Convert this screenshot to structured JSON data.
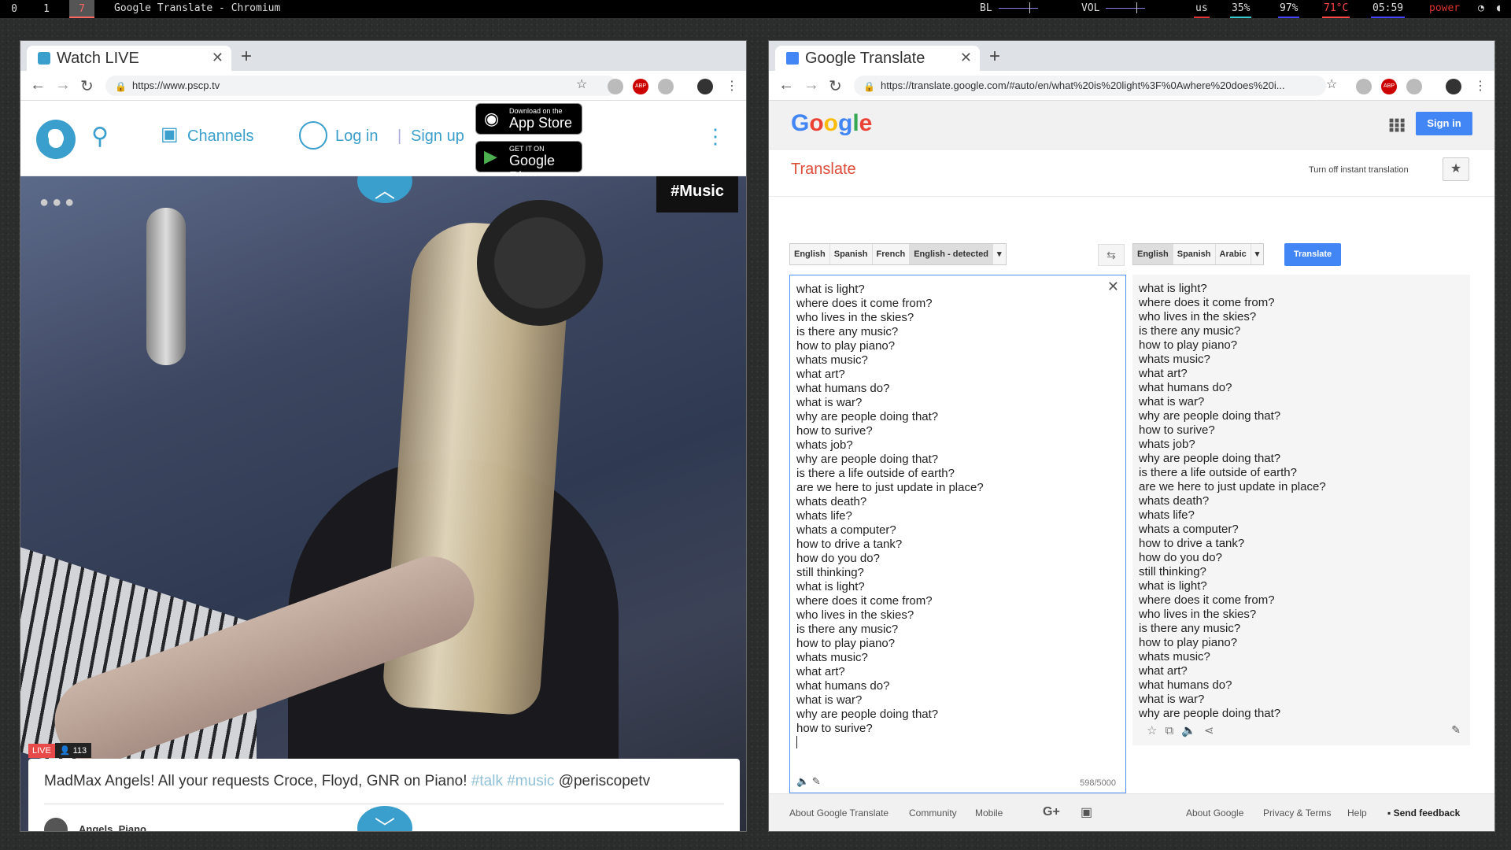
{
  "topbar": {
    "workspaces": [
      "0",
      "1",
      "7"
    ],
    "title": "Google Translate - Chromium",
    "bl_label": "BL",
    "vol_label": "VOL",
    "layout": "us",
    "cpu": "35%",
    "battery": "97%",
    "temp": "71°C",
    "time": "05:59",
    "power": "power"
  },
  "left": {
    "tab_title": "Watch LIVE",
    "url": "https://www.pscp.tv",
    "nav": {
      "channels": "Channels",
      "login": "Log in",
      "sep": "|",
      "signup": "Sign up"
    },
    "appstore": {
      "small": "Download on the",
      "big": "App Store"
    },
    "googleplay": {
      "small": "GET IT ON",
      "big": "Google Play"
    },
    "hashtag": "#Music",
    "live": "LIVE",
    "viewers": "113",
    "broadcast": {
      "title": "MadMax Angels! All your requests Croce, Floyd, GNR on Piano!",
      "tag1": "#talk",
      "tag2": "#music",
      "mention": "@periscopetv"
    },
    "username": "Angels_Piano"
  },
  "right": {
    "tab_title": "Google Translate",
    "url": "https://translate.google.com/#auto/en/what%20is%20light%3F%0Awhere%20does%20i...",
    "logo": "Google",
    "signin": "Sign in",
    "heading": "Translate",
    "instant": "Turn off instant translation",
    "source_langs": [
      "English",
      "Spanish",
      "French",
      "English - detected"
    ],
    "target_langs": [
      "English",
      "Spanish",
      "Arabic"
    ],
    "translate_btn": "Translate",
    "char_count": "598/5000",
    "source_lines": [
      "what is light?",
      "where does it come from?",
      "who lives in the skies?",
      "is there any music?",
      "how to play piano?",
      "whats music?",
      "what art?",
      "what humans do?",
      "what is war?",
      "why are people doing that?",
      "how to surive?",
      "whats job?",
      "why are people doing that?",
      "is there a life outside of earth?",
      "are we here to just update in place?",
      "whats death?",
      "whats life?",
      "whats a computer?",
      "how to drive a tank?",
      "how do you do?",
      "still thinking?",
      "what is light?",
      "where does it come from?",
      "who lives in the skies?",
      "is there any music?",
      "how to play piano?",
      "whats music?",
      "what art?",
      "what humans do?",
      "what is war?",
      "why are people doing that?",
      "how to surive?"
    ],
    "target_lines": [
      "what is light?",
      "where does it come from?",
      "who lives in the skies?",
      "is there any music?",
      "how to play piano?",
      "whats music?",
      "what art?",
      "what humans do?",
      "what is war?",
      "why are people doing that?",
      "how to surive?",
      "whats job?",
      "why are people doing that?",
      "is there a life outside of earth?",
      "are we here to just update in place?",
      "whats death?",
      "whats life?",
      "whats a computer?",
      "how to drive a tank?",
      "how do you do?",
      "still thinking?",
      "what is light?",
      "where does it come from?",
      "who lives in the skies?",
      "is there any music?",
      "how to play piano?",
      "whats music?",
      "what art?",
      "what humans do?",
      "what is war?",
      "why are people doing that?"
    ],
    "footer": {
      "about_translate": "About Google Translate",
      "community": "Community",
      "mobile": "Mobile",
      "gplus": "G+",
      "about_google": "About Google",
      "privacy": "Privacy & Terms",
      "help": "Help",
      "feedback": "Send feedback"
    }
  },
  "colors": {
    "periscope": "#3a9fcc",
    "google_blue": "#4285f4",
    "translate_red": "#dd4b39"
  }
}
